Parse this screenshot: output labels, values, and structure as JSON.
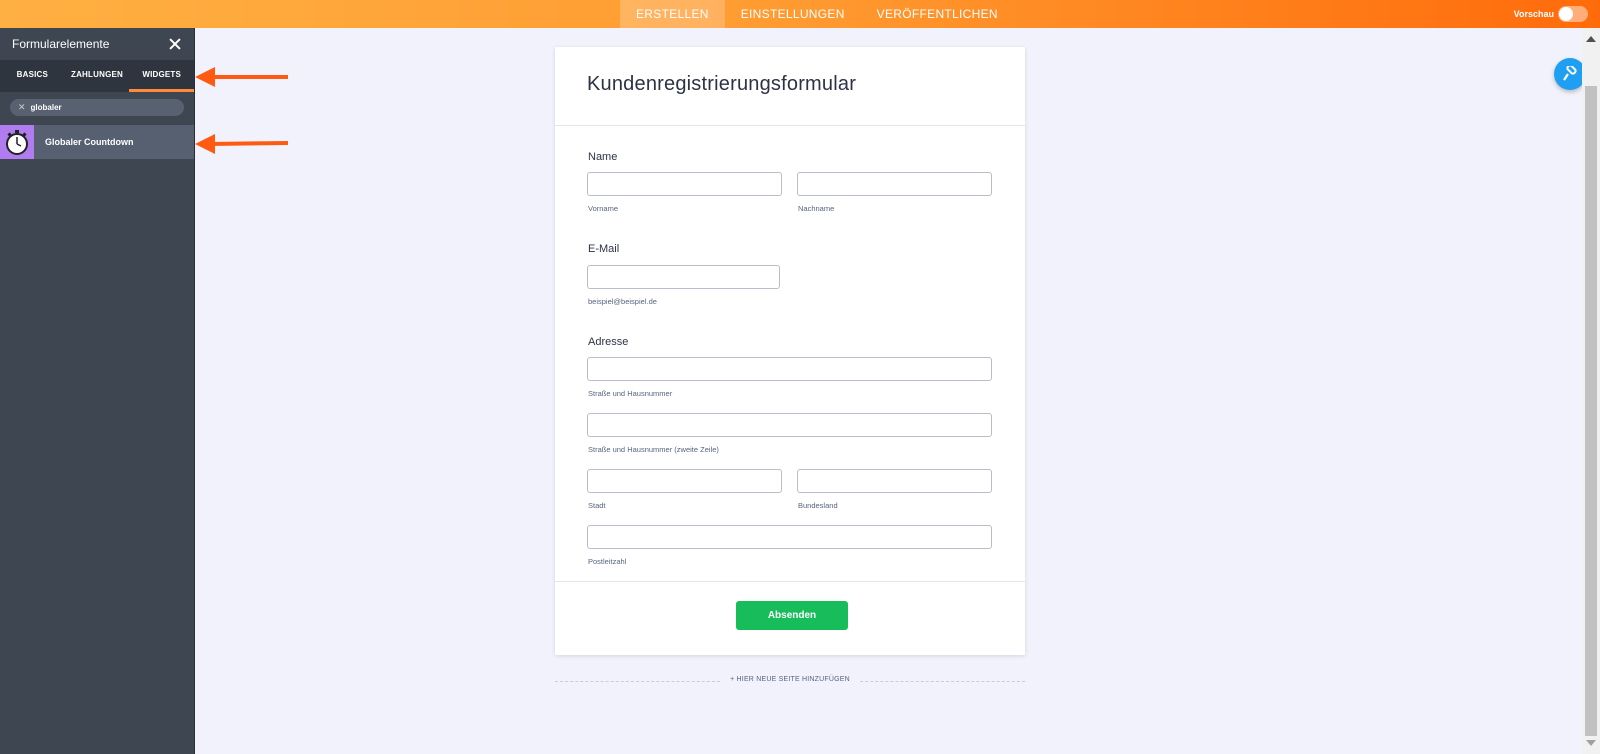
{
  "topbar": {
    "tabs": [
      "ERSTELLEN",
      "EINSTELLUNGEN",
      "VERÖFFENTLICHEN"
    ],
    "active_tab": "ERSTELLEN",
    "preview_label": "Vorschau",
    "preview_on": false
  },
  "sidebar": {
    "title": "Formularelemente",
    "tabs": [
      "BASICS",
      "ZAHLUNGEN",
      "WIDGETS"
    ],
    "active_tab": "WIDGETS",
    "search_value": "globaler",
    "result_label": "Globaler Countdown",
    "result_icon": "stopwatch-icon"
  },
  "form": {
    "title": "Kundenregistrierungsformular",
    "name_label": "Name",
    "first_name_sub": "Vorname",
    "last_name_sub": "Nachname",
    "email_label": "E-Mail",
    "email_sub": "beispiel@beispiel.de",
    "address_label": "Adresse",
    "street1_sub": "Straße und Hausnummer",
    "street2_sub": "Straße und Hausnummer (zweite Zeile)",
    "city_sub": "Stadt",
    "state_sub": "Bundesland",
    "zip_sub": "Postleitzahl",
    "submit_label": "Absenden"
  },
  "add_page_label": "+ HIER NEUE SEITE HINZUFÜGEN",
  "colors": {
    "accent_orange": "#ff6b0b",
    "sidebar_bg": "#3e4652",
    "submit_green": "#18bd5b",
    "fab_blue": "#1e9ff2",
    "widget_icon_bg": "#b17cf0"
  }
}
